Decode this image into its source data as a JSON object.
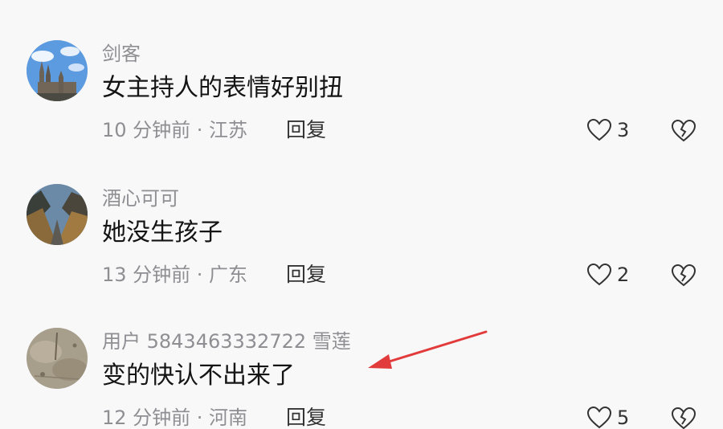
{
  "comments": [
    {
      "username": "剑客",
      "text": "女主持人的表情好别扭",
      "time": "10 分钟前 · 江苏",
      "reply_label": "回复",
      "likes": "3"
    },
    {
      "username": "酒心可可",
      "text": "她没生孩子",
      "time": "13 分钟前 · 广东",
      "reply_label": "回复",
      "likes": "2"
    },
    {
      "username": "用户 5843463332722 雪莲",
      "text": "变的快认不出来了",
      "time": "12 分钟前 · 河南",
      "reply_label": "回复",
      "likes": "5"
    }
  ],
  "colors": {
    "background": "#f8f8f9",
    "annotation_arrow": "#e23b3b"
  },
  "icons": {
    "like": "heart-outline-icon",
    "dislike": "broken-heart-icon"
  }
}
